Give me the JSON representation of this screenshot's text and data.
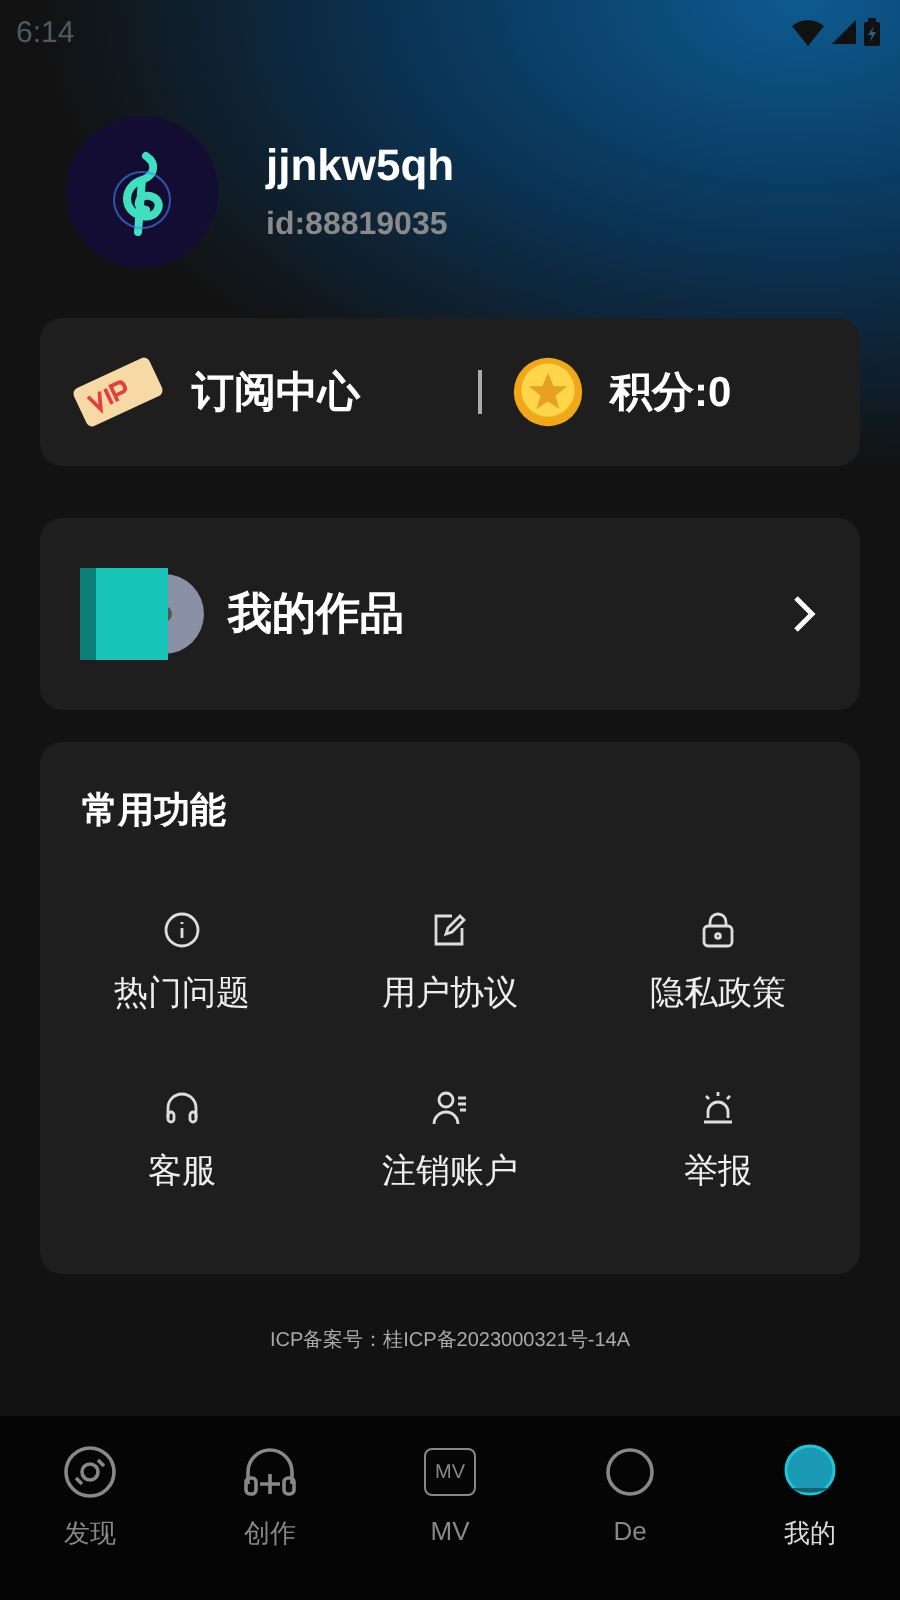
{
  "status_bar": {
    "time": "6:14"
  },
  "profile": {
    "name": "jjnkw5qh",
    "id": "id:88819035"
  },
  "subscription": {
    "label": "订阅中心",
    "points": "积分:0"
  },
  "works": {
    "label": "我的作品"
  },
  "functions": {
    "title": "常用功能",
    "items": [
      {
        "kind": "info",
        "label": "热门问题"
      },
      {
        "kind": "edit",
        "label": "用户协议"
      },
      {
        "kind": "lock",
        "label": "隐私政策"
      },
      {
        "kind": "headset",
        "label": "客服"
      },
      {
        "kind": "user",
        "label": "注销账户"
      },
      {
        "kind": "alarm",
        "label": "举报"
      }
    ]
  },
  "icp": "ICP备案号：桂ICP备2023000321号-14A",
  "tabs": [
    {
      "kind": "disc",
      "label": "发现",
      "selected": false
    },
    {
      "kind": "create",
      "label": "创作",
      "selected": false
    },
    {
      "kind": "mv",
      "label": "MV",
      "icon_text": "MV",
      "selected": false
    },
    {
      "kind": "demo",
      "label": "De",
      "selected": false
    },
    {
      "kind": "me",
      "label": "我的",
      "selected": true
    }
  ]
}
